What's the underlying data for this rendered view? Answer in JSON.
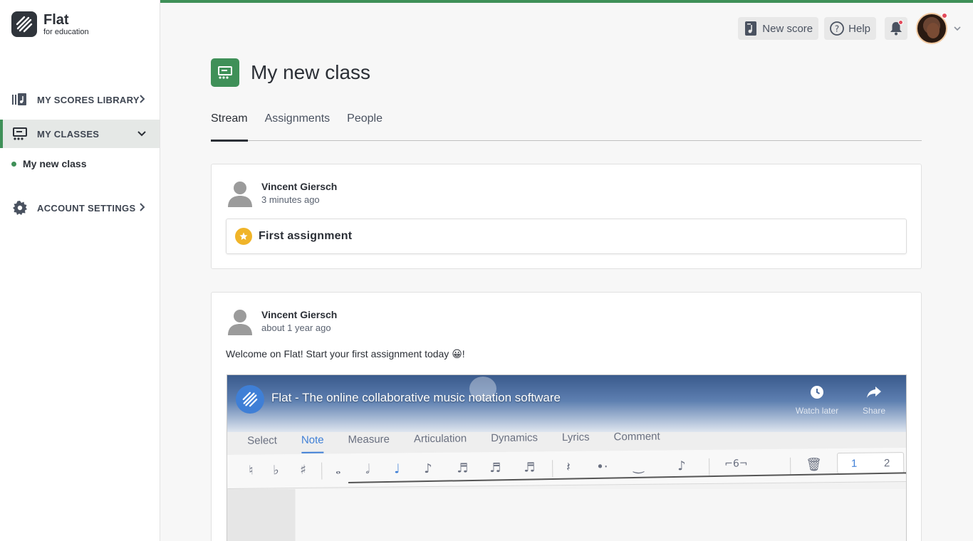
{
  "brand": {
    "name": "Flat",
    "subtitle": "for education"
  },
  "sidebar": {
    "items": [
      {
        "label": "MY SCORES LIBRARY",
        "icon": "library-icon"
      },
      {
        "label": "MY CLASSES",
        "icon": "classes-icon",
        "active": true
      },
      {
        "label": "ACCOUNT SETTINGS",
        "icon": "gear-icon"
      }
    ],
    "sub_items": [
      {
        "label": "My new class"
      }
    ]
  },
  "topbar": {
    "new_score_label": "New score",
    "help_label": "Help"
  },
  "page": {
    "title": "My new class",
    "tabs": [
      {
        "label": "Stream",
        "active": true
      },
      {
        "label": "Assignments"
      },
      {
        "label": "People"
      }
    ]
  },
  "stream": {
    "posts": [
      {
        "author": "Vincent Giersch",
        "time": "3 minutes ago",
        "assignment_title": "First assignment"
      },
      {
        "author": "Vincent Giersch",
        "time": "about 1 year ago",
        "message": "Welcome on Flat! Start your first assignment today 😀!",
        "video": {
          "title": "Flat - The online collaborative music notation software",
          "watch_later": "Watch later",
          "share": "Share",
          "editor_tabs": [
            "Select",
            "Note",
            "Measure",
            "Articulation",
            "Dynamics",
            "Lyrics",
            "Comment"
          ],
          "selected_editor_tab": "Note",
          "tuplet_label": "⌐6¬",
          "voices": [
            "1",
            "2"
          ]
        }
      }
    ]
  },
  "colors": {
    "accent": "#3f9058",
    "text": "#2b2f36",
    "badge": "#f0b429",
    "notification": "#e24a5b"
  }
}
